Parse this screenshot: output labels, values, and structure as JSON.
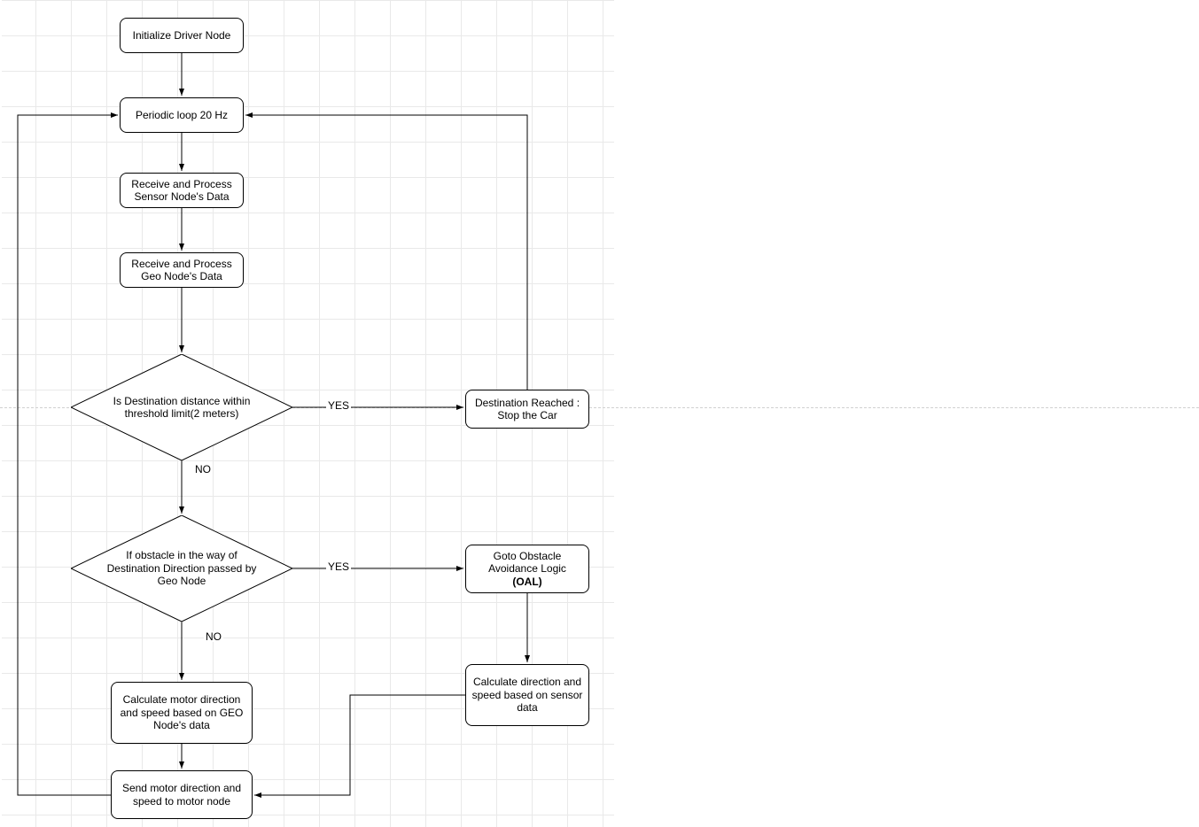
{
  "nodes": {
    "init": "Initialize Driver Node",
    "loop": "Periodic loop 20 Hz",
    "recv_sensor": "Receive and Process Sensor Node's Data",
    "recv_geo": "Receive and Process Geo Node's Data",
    "dec_dest": "Is Destination distance within threshold limit(2 meters)",
    "dest_reached": "Destination Reached : Stop the Car",
    "dec_obstacle": "If obstacle in the way of Destination Direction passed by Geo Node",
    "oal_line1": "Goto Obstacle Avoidance Logic",
    "oal_line2": "(OAL)",
    "calc_geo": "Calculate motor direction and speed based on GEO Node's data",
    "calc_sensor": "Calculate direction and speed based on sensor data",
    "send": "Send motor direction and speed to motor node"
  },
  "edge_labels": {
    "yes1": "YES",
    "no1": "NO",
    "yes2": "YES",
    "no2": "NO"
  }
}
